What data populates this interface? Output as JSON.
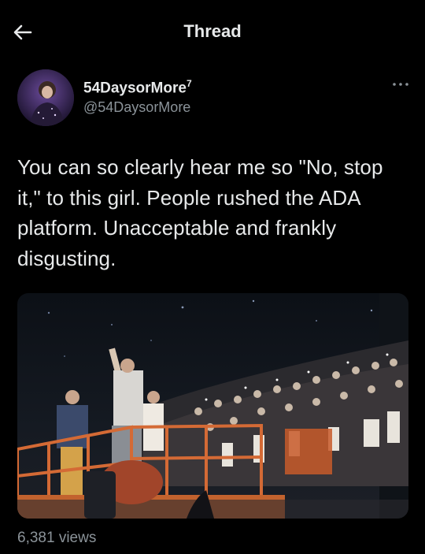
{
  "header": {
    "title": "Thread",
    "back_icon": "arrow-left-icon"
  },
  "author": {
    "display_name": "54DaysorMore",
    "superscript": "7",
    "handle": "@54DaysorMore",
    "more_icon": "more-horizontal-icon"
  },
  "tweet": {
    "text": "You can so clearly hear me so \"No, stop it,\" to this girl. People rushed the ADA platform. Unacceptable and frankly disgusting.",
    "views": "6,381 views"
  },
  "colors": {
    "background": "#000000",
    "text": "#e7e9ea",
    "muted": "#8b9399"
  }
}
